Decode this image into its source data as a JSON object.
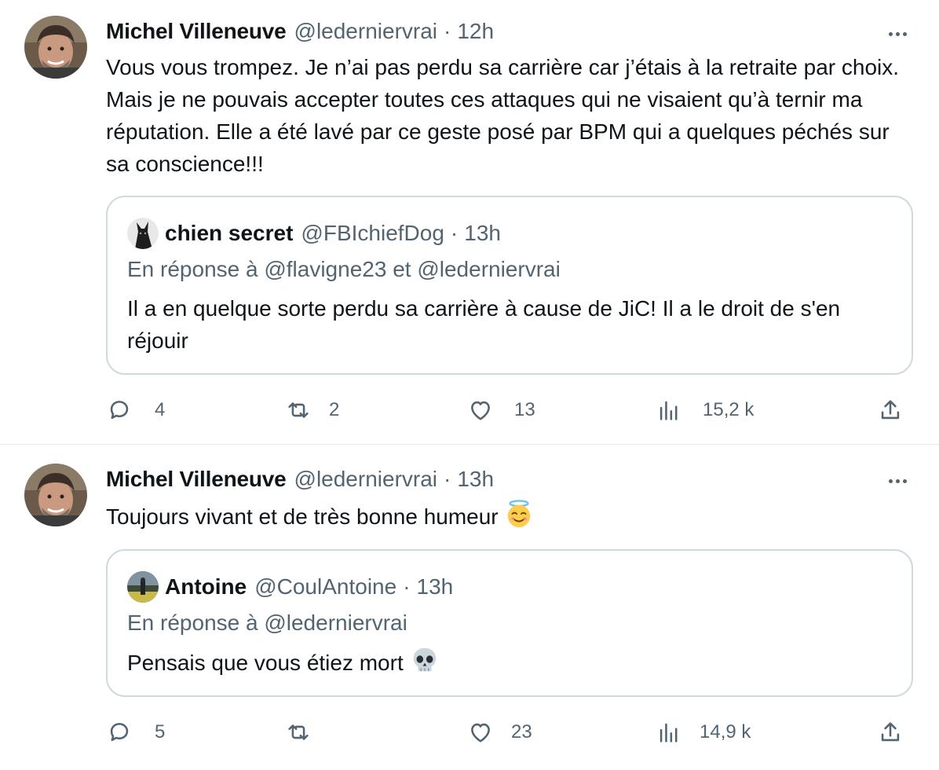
{
  "tweets": [
    {
      "author": {
        "name": "Michel Villeneuve",
        "handle": "@lederniervrai",
        "time": "12h"
      },
      "text": "Vous vous trompez.  Je n’ai pas perdu sa carrière car j’étais à la retraite par choix.  Mais je ne pouvais accepter toutes ces attaques qui ne visaient qu’à ternir ma réputation.  Elle a été lavé par ce geste posé par BPM qui a quelques péchés sur sa conscience!!!",
      "quote": {
        "name": "chien secret",
        "handle": "@FBIchiefDog",
        "time": "13h",
        "reply_to": "En réponse à @flavigne23  et  @lederniervrai",
        "text": "Il a en quelque sorte perdu sa carrière à cause de JiC! Il a le droit de s'en réjouir"
      },
      "stats": {
        "replies": "4",
        "retweets": "2",
        "likes": "13",
        "views": "15,2 k"
      }
    },
    {
      "author": {
        "name": "Michel Villeneuve",
        "handle": "@lederniervrai",
        "time": "13h"
      },
      "text": "Toujours vivant et de très bonne humeur",
      "quote": {
        "name": "Antoine",
        "handle": "@CoulAntoine",
        "time": "13h",
        "reply_to": "En réponse à @lederniervrai",
        "text": "Pensais que vous étiez mort"
      },
      "stats": {
        "replies": "5",
        "retweets": "",
        "likes": "23",
        "views": "14,9 k"
      }
    }
  ],
  "colors": {
    "text": "#0f1419",
    "secondary": "#536471",
    "border": "#cfd9de",
    "divider": "#e7e9ea"
  },
  "icons": [
    "avatar",
    "more-icon",
    "reply-icon",
    "retweet-icon",
    "like-icon",
    "views-icon",
    "share-icon",
    "smiling-halo-emoji",
    "skull-emoji"
  ]
}
